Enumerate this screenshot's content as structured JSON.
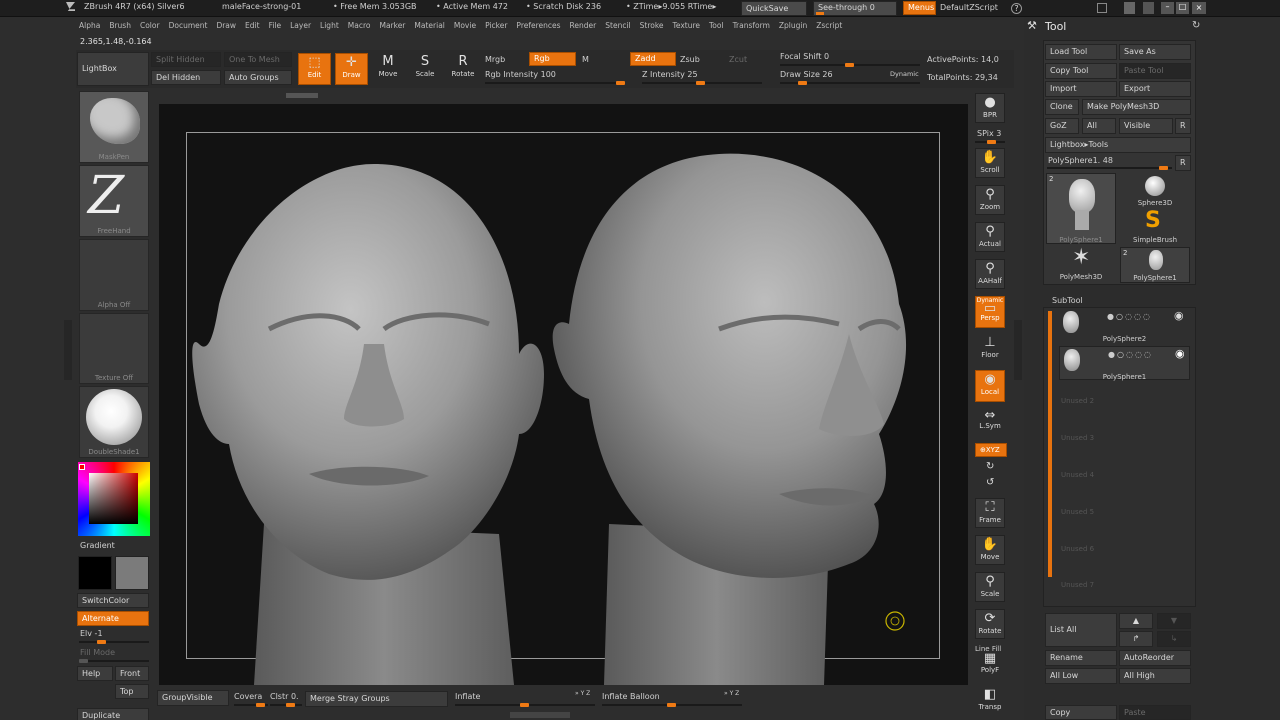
{
  "title_bar": {
    "app_title": "ZBrush 4R7 (x64) Silver6",
    "document": "maleFace-strong-01",
    "free_mem": "• Free Mem 3.053GB",
    "active_mem": "• Active Mem 472",
    "scratch_disk": "• Scratch Disk 236",
    "ztime": "• ZTime▸9.055 RTime▸",
    "quicksave": "QuickSave",
    "see_through": "See-through  0",
    "menus": "Menus",
    "default_zscript": "DefaultZScript"
  },
  "menu_bar": [
    "Alpha",
    "Brush",
    "Color",
    "Document",
    "Draw",
    "Edit",
    "File",
    "Layer",
    "Light",
    "Macro",
    "Marker",
    "Material",
    "Movie",
    "Picker",
    "Preferences",
    "Render",
    "Stencil",
    "Stroke",
    "Texture",
    "Tool",
    "Transform",
    "Zplugin",
    "Zscript"
  ],
  "coords": "2.365,1.48,-0.164",
  "top_shelf": {
    "lightbox": "LightBox",
    "split_hidden": "Split Hidden",
    "one_to_mesh": "One To Mesh",
    "del_hidden": "Del Hidden",
    "auto_groups": "Auto Groups",
    "edit": "Edit",
    "draw": "Draw",
    "move": "Move",
    "scale": "Scale",
    "rotate": "Rotate",
    "mrgb": "Mrgb",
    "rgb": "Rgb",
    "m": "M",
    "zadd": "Zadd",
    "zsub": "Zsub",
    "zcut": "Zcut",
    "rgb_intensity": "Rgb Intensity 100",
    "z_intensity": "Z Intensity 25",
    "focal_shift": "Focal Shift 0",
    "draw_size": "Draw Size 26",
    "dynamic": "Dynamic",
    "active_points": "ActivePoints: 14,0",
    "total_points": "TotalPoints: 29,34"
  },
  "left_shelf": {
    "brush_caption": "MaskPen",
    "stroke_caption": "FreeHand",
    "alpha_caption": "Alpha Off",
    "texture_caption": "Texture Off",
    "material_caption": "DoubleShade1",
    "gradient": "Gradient",
    "switch_color": "SwitchColor",
    "alternate": "Alternate",
    "elv": "Elv -1",
    "fill_mode": "Fill Mode",
    "help": "Help",
    "front": "Front",
    "top": "Top",
    "duplicate": "Duplicate"
  },
  "right_shelf": {
    "bpr": "BPR",
    "spix": "SPix 3",
    "scroll": "Scroll",
    "zoom": "Zoom",
    "actual": "Actual",
    "aahalf": "AAHalf",
    "dynamic": "Dynamic",
    "persp": "Persp",
    "floor": "Floor",
    "local": "Local",
    "lsym": "L.Sym",
    "xyz": "⊕XYZ",
    "frame": "Frame",
    "move": "Move",
    "scale": "Scale",
    "rotate": "Rotate",
    "line_fill": "Line Fill",
    "polyf": "PolyF",
    "transp": "Transp"
  },
  "bottom_bar": {
    "group_visible": "GroupVisible",
    "coverage": "Covera",
    "clstr": "Clstr 0.",
    "merge_stray": "Merge Stray Groups",
    "inflate": "Inflate",
    "inflate_balloon": "Inflate Balloon",
    "xyz1": "» Y Z",
    "xyz2": "» Y Z"
  },
  "tool_panel": {
    "title": "Tool",
    "load_tool": "Load Tool",
    "save_as": "Save As",
    "copy_tool": "Copy Tool",
    "paste_tool": "Paste Tool",
    "import": "Import",
    "export": "Export",
    "clone": "Clone",
    "make_polymesh": "Make PolyMesh3D",
    "goz": "GoZ",
    "all": "All",
    "visible": "Visible",
    "r": "R",
    "lightbox_tools": "Lightbox▸Tools",
    "polysphere_slider": "PolySphere1. 48",
    "r2": "R",
    "tools": [
      {
        "name": "PolySphere1",
        "badge": "2"
      },
      {
        "name": "Sphere3D",
        "badge": ""
      },
      {
        "name": "SimpleBrush",
        "badge": ""
      },
      {
        "name": "PolyMesh3D",
        "badge": ""
      },
      {
        "name": "PolySphere1",
        "badge": "2"
      }
    ],
    "subtool": "SubTool",
    "subtools": [
      "PolySphere2",
      "PolySphere1"
    ],
    "unused": [
      "Unused 2",
      "Unused 3",
      "Unused 4",
      "Unused 5",
      "Unused 6",
      "Unused 7"
    ],
    "list_all": "List All",
    "rename": "Rename",
    "auto_reorder": "AutoReorder",
    "all_low": "All Low",
    "all_high": "All High",
    "copy": "Copy",
    "paste": "Paste"
  }
}
